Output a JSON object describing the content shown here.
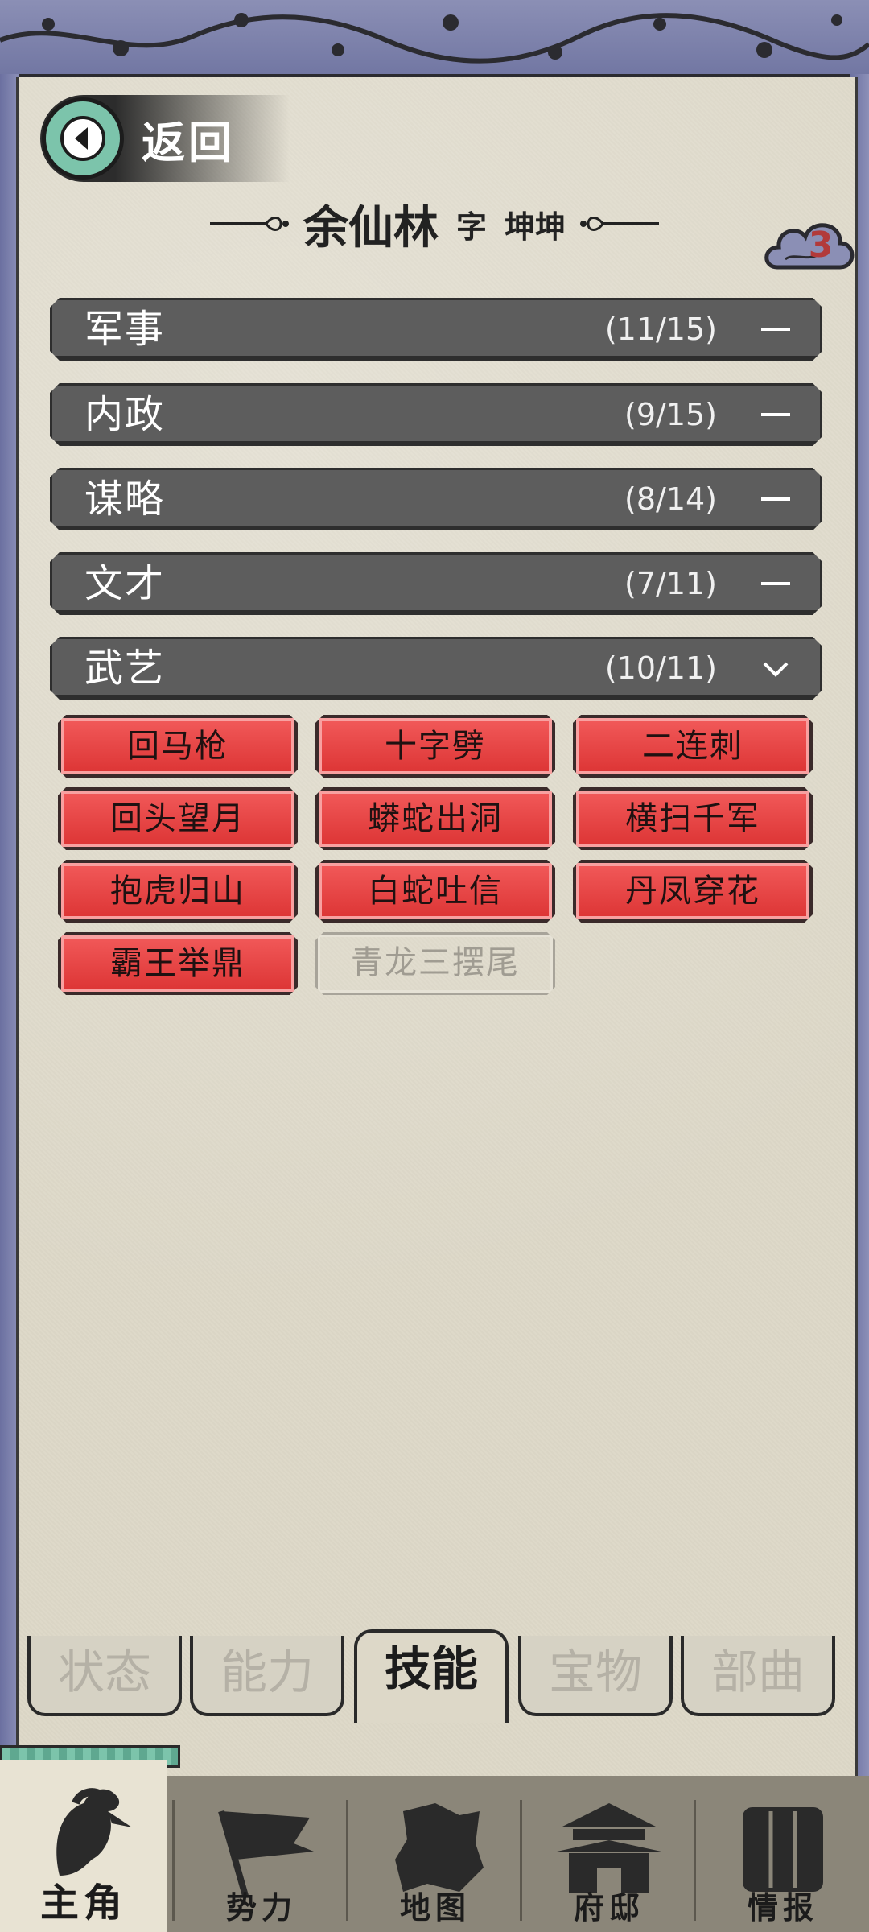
{
  "header": {
    "back_label": "返回",
    "name": "余仙林",
    "zi_label": "字",
    "courtesy_name": "坤坤",
    "badge_count": "3"
  },
  "categories": [
    {
      "name": "军事",
      "count": "(11/15)",
      "state": "collapsed",
      "toggle_icon": "minus-icon"
    },
    {
      "name": "内政",
      "count": "(9/15)",
      "state": "collapsed",
      "toggle_icon": "minus-icon"
    },
    {
      "name": "谋略",
      "count": "(8/14)",
      "state": "collapsed",
      "toggle_icon": "minus-icon"
    },
    {
      "name": "文才",
      "count": "(7/11)",
      "state": "collapsed",
      "toggle_icon": "minus-icon"
    },
    {
      "name": "武艺",
      "count": "(10/11)",
      "state": "expanded",
      "toggle_icon": "chevron-down-icon"
    }
  ],
  "skills": [
    {
      "label": "回马枪",
      "learned": true
    },
    {
      "label": "十字劈",
      "learned": true
    },
    {
      "label": "二连刺",
      "learned": true
    },
    {
      "label": "回头望月",
      "learned": true
    },
    {
      "label": "蟒蛇出洞",
      "learned": true
    },
    {
      "label": "横扫千军",
      "learned": true
    },
    {
      "label": "抱虎归山",
      "learned": true
    },
    {
      "label": "白蛇吐信",
      "learned": true
    },
    {
      "label": "丹凤穿花",
      "learned": true
    },
    {
      "label": "霸王举鼎",
      "learned": true
    },
    {
      "label": "青龙三摆尾",
      "learned": false
    }
  ],
  "tabs": [
    {
      "label": "状态",
      "active": false
    },
    {
      "label": "能力",
      "active": false
    },
    {
      "label": "技能",
      "active": true
    },
    {
      "label": "宝物",
      "active": false
    },
    {
      "label": "部曲",
      "active": false
    }
  ],
  "bottom_nav": [
    {
      "label": "主角",
      "icon": "warrior-head-icon",
      "active": true
    },
    {
      "label": "势力",
      "icon": "flag-icon",
      "active": false
    },
    {
      "label": "地图",
      "icon": "map-icon",
      "active": false
    },
    {
      "label": "府邸",
      "icon": "palace-icon",
      "active": false
    },
    {
      "label": "情报",
      "icon": "scroll-icon",
      "active": false
    }
  ],
  "colors": {
    "skill_learned": "#e84444",
    "category_bar": "#5d5d5d",
    "paper": "#ddd8c8",
    "accent_teal": "#7cc4ab",
    "border_purple": "#7f84ad"
  }
}
